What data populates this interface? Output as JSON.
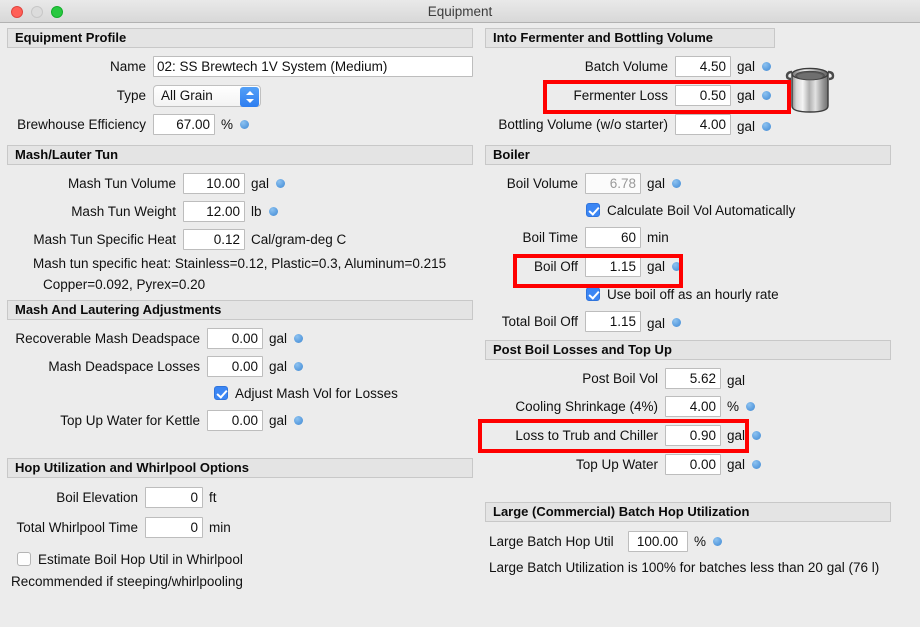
{
  "window": {
    "title": "Equipment",
    "traffic_lights": [
      "close-red",
      "minimize-gray",
      "zoom-green"
    ]
  },
  "left": {
    "equipment_profile": {
      "header": "Equipment Profile",
      "name_label": "Name",
      "name_value": "02: SS Brewtech 1V System (Medium)",
      "type_label": "Type",
      "type_value": "All Grain",
      "efficiency_label": "Brewhouse Efficiency",
      "efficiency_value": "67.00",
      "efficiency_unit": "%"
    },
    "mash_lauter_tun": {
      "header": "Mash/Lauter Tun",
      "rows": [
        {
          "label": "Mash Tun Volume",
          "value": "10.00",
          "unit": "gal",
          "dot": true
        },
        {
          "label": "Mash Tun Weight",
          "value": "12.00",
          "unit": "lb",
          "dot": true
        },
        {
          "label": "Mash Tun Specific Heat",
          "value": "0.12",
          "unit": "Cal/gram-deg C",
          "dot": false
        }
      ],
      "note_line1": "Mash tun specific heat: Stainless=0.12, Plastic=0.3, Aluminum=0.215",
      "note_line2": "Copper=0.092, Pyrex=0.20"
    },
    "mash_adjustments": {
      "header": "Mash And Lautering Adjustments",
      "rows": [
        {
          "label": "Recoverable Mash Deadspace",
          "value": "0.00",
          "unit": "gal",
          "dot": true
        },
        {
          "label": "Mash Deadspace Losses",
          "value": "0.00",
          "unit": "gal",
          "dot": true
        }
      ],
      "checkbox_label": "Adjust Mash Vol for Losses",
      "checkbox_checked": true,
      "topup_label": "Top Up Water for Kettle",
      "topup_value": "0.00",
      "topup_unit": "gal"
    },
    "hop_utilization": {
      "header": "Hop Utilization and Whirlpool Options",
      "rows": [
        {
          "label": "Boil Elevation",
          "value": "0",
          "unit": "ft"
        },
        {
          "label": "Total Whirlpool Time",
          "value": "0",
          "unit": "min"
        }
      ],
      "checkbox_label": "Estimate Boil Hop Util in Whirlpool",
      "checkbox_checked": false,
      "note": "Recommended if steeping/whirlpooling"
    }
  },
  "right": {
    "fermenter": {
      "header": "Into Fermenter and Bottling Volume",
      "batch_label": "Batch Volume",
      "batch_value": "4.50",
      "batch_unit": "gal",
      "loss_label": "Fermenter Loss",
      "loss_value": "0.50",
      "loss_unit": "gal",
      "bottling_label": "Bottling Volume (w/o starter)",
      "bottling_value": "4.00",
      "bottling_unit": "gal"
    },
    "boiler": {
      "header": "Boiler",
      "boil_vol_label": "Boil Volume",
      "boil_vol_value": "6.78",
      "boil_vol_unit": "gal",
      "auto_checkbox_label": "Calculate Boil Vol Automatically",
      "auto_checkbox_checked": true,
      "boil_time_label": "Boil Time",
      "boil_time_value": "60",
      "boil_time_unit": "min",
      "boil_off_label": "Boil Off",
      "boil_off_value": "1.15",
      "boil_off_unit": "gal",
      "hourly_checkbox_label": "Use boil off as an hourly rate",
      "hourly_checkbox_checked": true,
      "total_boil_off_label": "Total Boil Off",
      "total_boil_off_value": "1.15",
      "total_boil_off_unit": "gal"
    },
    "post_boil": {
      "header": "Post Boil Losses and Top Up",
      "post_boil_vol_label": "Post Boil Vol",
      "post_boil_vol_value": "5.62",
      "post_boil_vol_unit": "gal",
      "cooling_label": "Cooling Shrinkage (4%)",
      "cooling_value": "4.00",
      "cooling_unit": "%",
      "trub_label": "Loss to Trub and Chiller",
      "trub_value": "0.90",
      "trub_unit": "gal",
      "topup_label": "Top Up Water",
      "topup_value": "0.00",
      "topup_unit": "gal"
    },
    "large_batch": {
      "header": "Large (Commercial) Batch Hop Utilization",
      "util_label": "Large Batch Hop Util",
      "util_value": "100.00",
      "util_unit": "%",
      "note": "Large Batch Utilization is 100% for batches less than 20 gal (76 l)"
    }
  },
  "annotations": {
    "highlight_color": "#ff0000",
    "highlighted_fields": [
      "Fermenter Loss",
      "Boil Off",
      "Loss to Trub and Chiller"
    ]
  },
  "icons": {
    "kettle": "brew-kettle-icon"
  }
}
